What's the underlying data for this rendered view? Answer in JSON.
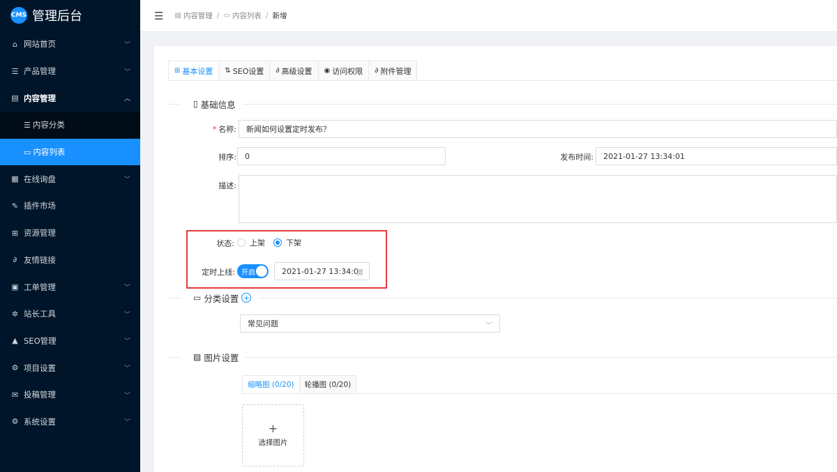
{
  "app": {
    "logo_badge": "CMS",
    "title": "管理后台"
  },
  "sidebar": {
    "items": [
      {
        "label": "网站首页",
        "icon": "home-icon",
        "glyph": "⌂",
        "arrow": "﹀"
      },
      {
        "label": "产品管理",
        "icon": "list-icon",
        "glyph": "☰",
        "arrow": "﹀"
      },
      {
        "label": "内容管理",
        "icon": "newspaper-icon",
        "glyph": "▤",
        "arrow": "︿"
      },
      {
        "label": "在线询盘",
        "icon": "table-icon",
        "glyph": "▦",
        "arrow": "﹀"
      },
      {
        "label": "插件市场",
        "icon": "pin-icon",
        "glyph": "✎",
        "arrow": ""
      },
      {
        "label": "资源管理",
        "icon": "grid-icon",
        "glyph": "⊞",
        "arrow": ""
      },
      {
        "label": "友情链接",
        "icon": "link-icon",
        "glyph": "∂",
        "arrow": ""
      },
      {
        "label": "工单管理",
        "icon": "document-icon",
        "glyph": "▣",
        "arrow": "﹀"
      },
      {
        "label": "站长工具",
        "icon": "gears-icon",
        "glyph": "✲",
        "arrow": "﹀"
      },
      {
        "label": "SEO管理",
        "icon": "warning-icon",
        "glyph": "▲",
        "arrow": "﹀"
      },
      {
        "label": "项目设置",
        "icon": "settings-icon",
        "glyph": "⚙",
        "arrow": "﹀"
      },
      {
        "label": "投稿管理",
        "icon": "mail-icon",
        "glyph": "✉",
        "arrow": "﹀"
      },
      {
        "label": "系统设置",
        "icon": "settings-icon",
        "glyph": "⚙",
        "arrow": "﹀"
      }
    ],
    "submenu": [
      {
        "label": "内容分类",
        "icon": "category-icon",
        "glyph": "☰"
      },
      {
        "label": "内容列表",
        "icon": "list-icon",
        "glyph": "▭"
      }
    ]
  },
  "header": {
    "fold_glyph": "☰",
    "breadcrumb": [
      {
        "label": "内容管理",
        "glyph": "▤"
      },
      {
        "label": "内容列表",
        "glyph": "▭"
      },
      {
        "label": "新增"
      }
    ],
    "separator": "/"
  },
  "tabs": [
    {
      "label": "基本设置",
      "glyph": "⊞"
    },
    {
      "label": "SEO设置",
      "glyph": "⇅"
    },
    {
      "label": "高级设置",
      "glyph": "∂"
    },
    {
      "label": "访问权限",
      "glyph": "◉"
    },
    {
      "label": "附件管理",
      "glyph": "∂"
    }
  ],
  "sections": {
    "basic": {
      "title": "基础信息",
      "glyph": "▯"
    },
    "category": {
      "title": "分类设置",
      "glyph": "▭",
      "add_glyph": "+"
    },
    "images": {
      "title": "图片设置",
      "glyph": "▨"
    }
  },
  "form": {
    "name": {
      "required_mark": "*",
      "label": "名称:",
      "value": "新闻如何设置定时发布？"
    },
    "sort": {
      "label": "排序:",
      "value": "0"
    },
    "publish_time": {
      "label": "发布时间:",
      "value": "2021-01-27 13:34:01"
    },
    "description": {
      "label": "描述:",
      "value": ""
    },
    "status": {
      "label": "状态:",
      "options": [
        "上架",
        "下架"
      ],
      "selected": "下架"
    },
    "schedule": {
      "label": "定时上线:",
      "switch_text": "开启",
      "enabled": true,
      "datetime": "2021-01-27 13:34:0",
      "cal_glyph": "▦"
    },
    "category_select": {
      "value": "常见问题",
      "arrow": "﹀"
    }
  },
  "images": {
    "tabs": [
      "缩略图 (0/20)",
      "轮播图 (0/20)"
    ],
    "upload_plus": "+",
    "upload_label": "选择图片"
  },
  "colors": {
    "primary": "#1890ff",
    "sidebar_bg": "#001529",
    "highlight_border": "#e43a3a",
    "required": "#f5222d"
  }
}
